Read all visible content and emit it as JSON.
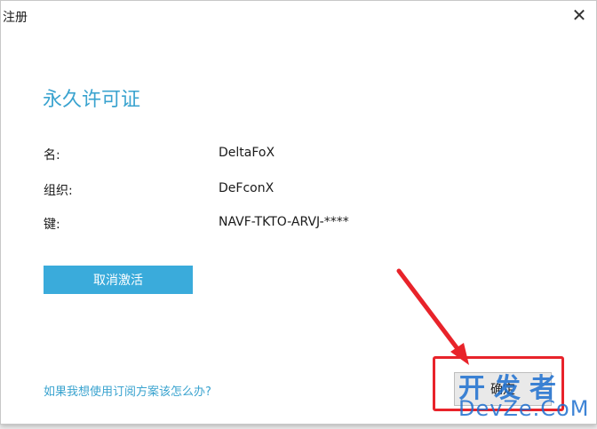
{
  "dialog": {
    "title": "注册",
    "close_glyph": "✕",
    "heading": "永久许可证",
    "fields": [
      {
        "label": "名:",
        "value": "DeltaFoX"
      },
      {
        "label": "组织:",
        "value": "DeFconX"
      },
      {
        "label": "键:",
        "value": "NAVF-TKTO-ARVJ-****"
      }
    ],
    "deactivate_label": "取消激活",
    "help_link": "如果我想使用订阅方案该怎么办?",
    "ok_label": "确定"
  },
  "watermark": {
    "top": "开发者",
    "bottom": "DevZe.CoM"
  },
  "colors": {
    "accent": "#3aabdb",
    "link": "#3aa3cf",
    "annotation": "#e8232a",
    "watermark": "#1d6fd0"
  }
}
